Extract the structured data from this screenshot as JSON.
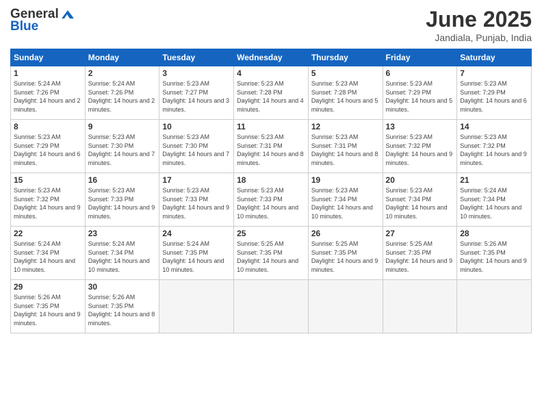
{
  "header": {
    "logo_general": "General",
    "logo_blue": "Blue",
    "month_title": "June 2025",
    "subtitle": "Jandiala, Punjab, India"
  },
  "weekdays": [
    "Sunday",
    "Monday",
    "Tuesday",
    "Wednesday",
    "Thursday",
    "Friday",
    "Saturday"
  ],
  "days": [
    {
      "num": "1",
      "sunrise": "5:24 AM",
      "sunset": "7:26 PM",
      "daylight": "14 hours and 2 minutes."
    },
    {
      "num": "2",
      "sunrise": "5:24 AM",
      "sunset": "7:26 PM",
      "daylight": "14 hours and 2 minutes."
    },
    {
      "num": "3",
      "sunrise": "5:23 AM",
      "sunset": "7:27 PM",
      "daylight": "14 hours and 3 minutes."
    },
    {
      "num": "4",
      "sunrise": "5:23 AM",
      "sunset": "7:28 PM",
      "daylight": "14 hours and 4 minutes."
    },
    {
      "num": "5",
      "sunrise": "5:23 AM",
      "sunset": "7:28 PM",
      "daylight": "14 hours and 5 minutes."
    },
    {
      "num": "6",
      "sunrise": "5:23 AM",
      "sunset": "7:29 PM",
      "daylight": "14 hours and 5 minutes."
    },
    {
      "num": "7",
      "sunrise": "5:23 AM",
      "sunset": "7:29 PM",
      "daylight": "14 hours and 6 minutes."
    },
    {
      "num": "8",
      "sunrise": "5:23 AM",
      "sunset": "7:29 PM",
      "daylight": "14 hours and 6 minutes."
    },
    {
      "num": "9",
      "sunrise": "5:23 AM",
      "sunset": "7:30 PM",
      "daylight": "14 hours and 7 minutes."
    },
    {
      "num": "10",
      "sunrise": "5:23 AM",
      "sunset": "7:30 PM",
      "daylight": "14 hours and 7 minutes."
    },
    {
      "num": "11",
      "sunrise": "5:23 AM",
      "sunset": "7:31 PM",
      "daylight": "14 hours and 8 minutes."
    },
    {
      "num": "12",
      "sunrise": "5:23 AM",
      "sunset": "7:31 PM",
      "daylight": "14 hours and 8 minutes."
    },
    {
      "num": "13",
      "sunrise": "5:23 AM",
      "sunset": "7:32 PM",
      "daylight": "14 hours and 9 minutes."
    },
    {
      "num": "14",
      "sunrise": "5:23 AM",
      "sunset": "7:32 PM",
      "daylight": "14 hours and 9 minutes."
    },
    {
      "num": "15",
      "sunrise": "5:23 AM",
      "sunset": "7:32 PM",
      "daylight": "14 hours and 9 minutes."
    },
    {
      "num": "16",
      "sunrise": "5:23 AM",
      "sunset": "7:33 PM",
      "daylight": "14 hours and 9 minutes."
    },
    {
      "num": "17",
      "sunrise": "5:23 AM",
      "sunset": "7:33 PM",
      "daylight": "14 hours and 9 minutes."
    },
    {
      "num": "18",
      "sunrise": "5:23 AM",
      "sunset": "7:33 PM",
      "daylight": "14 hours and 10 minutes."
    },
    {
      "num": "19",
      "sunrise": "5:23 AM",
      "sunset": "7:34 PM",
      "daylight": "14 hours and 10 minutes."
    },
    {
      "num": "20",
      "sunrise": "5:23 AM",
      "sunset": "7:34 PM",
      "daylight": "14 hours and 10 minutes."
    },
    {
      "num": "21",
      "sunrise": "5:24 AM",
      "sunset": "7:34 PM",
      "daylight": "14 hours and 10 minutes."
    },
    {
      "num": "22",
      "sunrise": "5:24 AM",
      "sunset": "7:34 PM",
      "daylight": "14 hours and 10 minutes."
    },
    {
      "num": "23",
      "sunrise": "5:24 AM",
      "sunset": "7:34 PM",
      "daylight": "14 hours and 10 minutes."
    },
    {
      "num": "24",
      "sunrise": "5:24 AM",
      "sunset": "7:35 PM",
      "daylight": "14 hours and 10 minutes."
    },
    {
      "num": "25",
      "sunrise": "5:25 AM",
      "sunset": "7:35 PM",
      "daylight": "14 hours and 10 minutes."
    },
    {
      "num": "26",
      "sunrise": "5:25 AM",
      "sunset": "7:35 PM",
      "daylight": "14 hours and 9 minutes."
    },
    {
      "num": "27",
      "sunrise": "5:25 AM",
      "sunset": "7:35 PM",
      "daylight": "14 hours and 9 minutes."
    },
    {
      "num": "28",
      "sunrise": "5:26 AM",
      "sunset": "7:35 PM",
      "daylight": "14 hours and 9 minutes."
    },
    {
      "num": "29",
      "sunrise": "5:26 AM",
      "sunset": "7:35 PM",
      "daylight": "14 hours and 9 minutes."
    },
    {
      "num": "30",
      "sunrise": "5:26 AM",
      "sunset": "7:35 PM",
      "daylight": "14 hours and 8 minutes."
    }
  ],
  "labels": {
    "sunrise": "Sunrise:",
    "sunset": "Sunset:",
    "daylight": "Daylight:"
  }
}
